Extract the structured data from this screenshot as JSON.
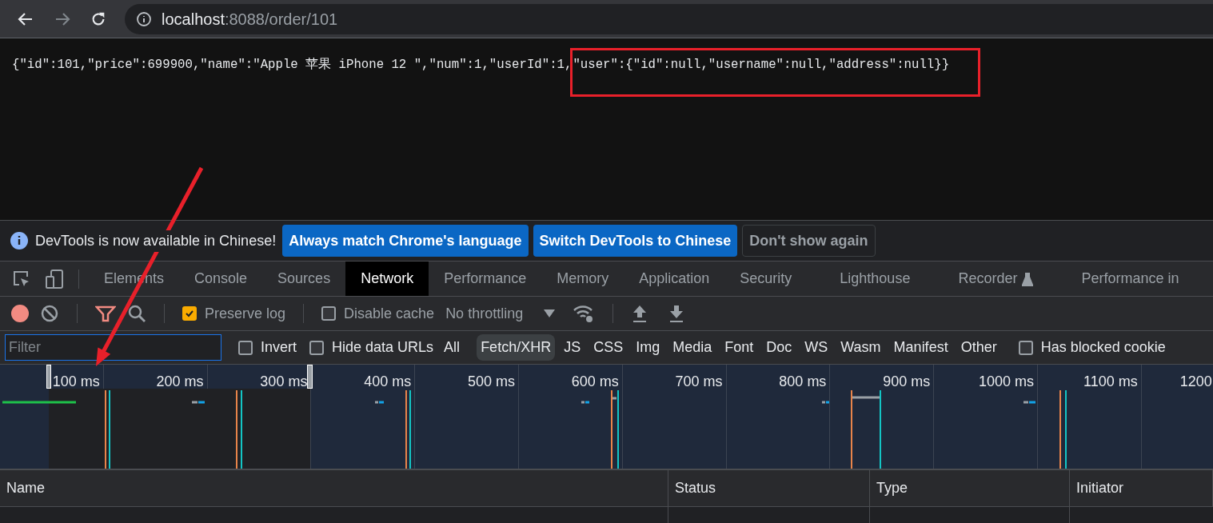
{
  "browser": {
    "url_host": "localhost",
    "url_rest": ":8088/order/101"
  },
  "page": {
    "json_text": "{\"id\":101,\"price\":699900,\"name\":\"Apple 苹果 iPhone 12 \",\"num\":1,\"userId\":1,",
    "highlighted_text": "\"user\":{\"id\":null,\"username\":null,\"address\":null}}"
  },
  "infobar": {
    "message": "DevTools is now available in Chinese!",
    "buttons": [
      {
        "label": "Always match Chrome's language",
        "kind": "primary"
      },
      {
        "label": "Switch DevTools to Chinese",
        "kind": "primary"
      },
      {
        "label": "Don't show again",
        "kind": "secondary"
      }
    ]
  },
  "tabs": [
    {
      "label": "Elements",
      "selected": false
    },
    {
      "label": "Console",
      "selected": false
    },
    {
      "label": "Sources",
      "selected": false
    },
    {
      "label": "Network",
      "selected": true
    },
    {
      "label": "Performance",
      "selected": false
    },
    {
      "label": "Memory",
      "selected": false
    },
    {
      "label": "Application",
      "selected": false
    },
    {
      "label": "Security",
      "selected": false
    },
    {
      "label": "Lighthouse",
      "selected": false
    },
    {
      "label": "Recorder",
      "selected": false,
      "experimental": true
    },
    {
      "label": "Performance in",
      "selected": false
    }
  ],
  "toolbar": {
    "recording": true,
    "preserve_log": {
      "label": "Preserve log",
      "checked": true
    },
    "disable_cache": {
      "label": "Disable cache",
      "checked": false
    },
    "throttling": "No throttling"
  },
  "filter": {
    "placeholder": "Filter",
    "invert": {
      "label": "Invert",
      "checked": false
    },
    "hide_data_urls": {
      "label": "Hide data URLs",
      "checked": false
    },
    "types": [
      {
        "label": "All",
        "selected": false
      },
      {
        "label": "Fetch/XHR",
        "selected": true
      },
      {
        "label": "JS",
        "selected": false
      },
      {
        "label": "CSS",
        "selected": false
      },
      {
        "label": "Img",
        "selected": false
      },
      {
        "label": "Media",
        "selected": false
      },
      {
        "label": "Font",
        "selected": false
      },
      {
        "label": "Doc",
        "selected": false
      },
      {
        "label": "WS",
        "selected": false
      },
      {
        "label": "Wasm",
        "selected": false
      },
      {
        "label": "Manifest",
        "selected": false
      },
      {
        "label": "Other",
        "selected": false
      }
    ],
    "blocked_cookies": {
      "label": "Has blocked cookie",
      "checked": false
    }
  },
  "timeline": {
    "ticks": [
      "100 ms",
      "200 ms",
      "300 ms",
      "400 ms",
      "500 ms",
      "600 ms",
      "700 ms",
      "800 ms",
      "900 ms",
      "1000 ms",
      "1100 ms",
      "1200"
    ]
  },
  "table": {
    "columns": [
      "Name",
      "Status",
      "Type",
      "Initiator"
    ]
  }
}
